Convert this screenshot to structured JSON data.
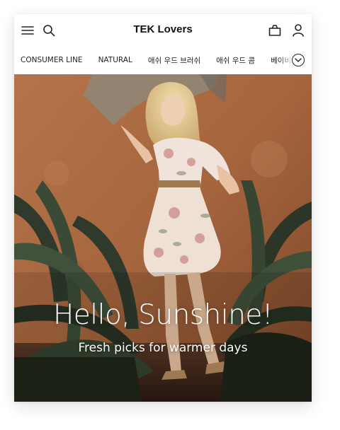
{
  "header": {
    "title": "TEK Lovers",
    "icons": [
      "menu-icon",
      "search-icon",
      "bag-icon",
      "user-icon"
    ]
  },
  "categories": {
    "items": [
      "CONSUMER LINE",
      "NATURAL",
      "애쉬 우드 브러쉬",
      "애쉬 우드 콤",
      "베이비"
    ],
    "more_icon": "chevron-down-circle-icon"
  },
  "hero": {
    "title": "Hello, Sunshine!",
    "subtitle": "Fresh picks for warmer days"
  },
  "colors": {
    "wall": "#a8673f",
    "foliage": "#2f3a2c",
    "dress": "#efe0d6",
    "text": "#222222"
  }
}
